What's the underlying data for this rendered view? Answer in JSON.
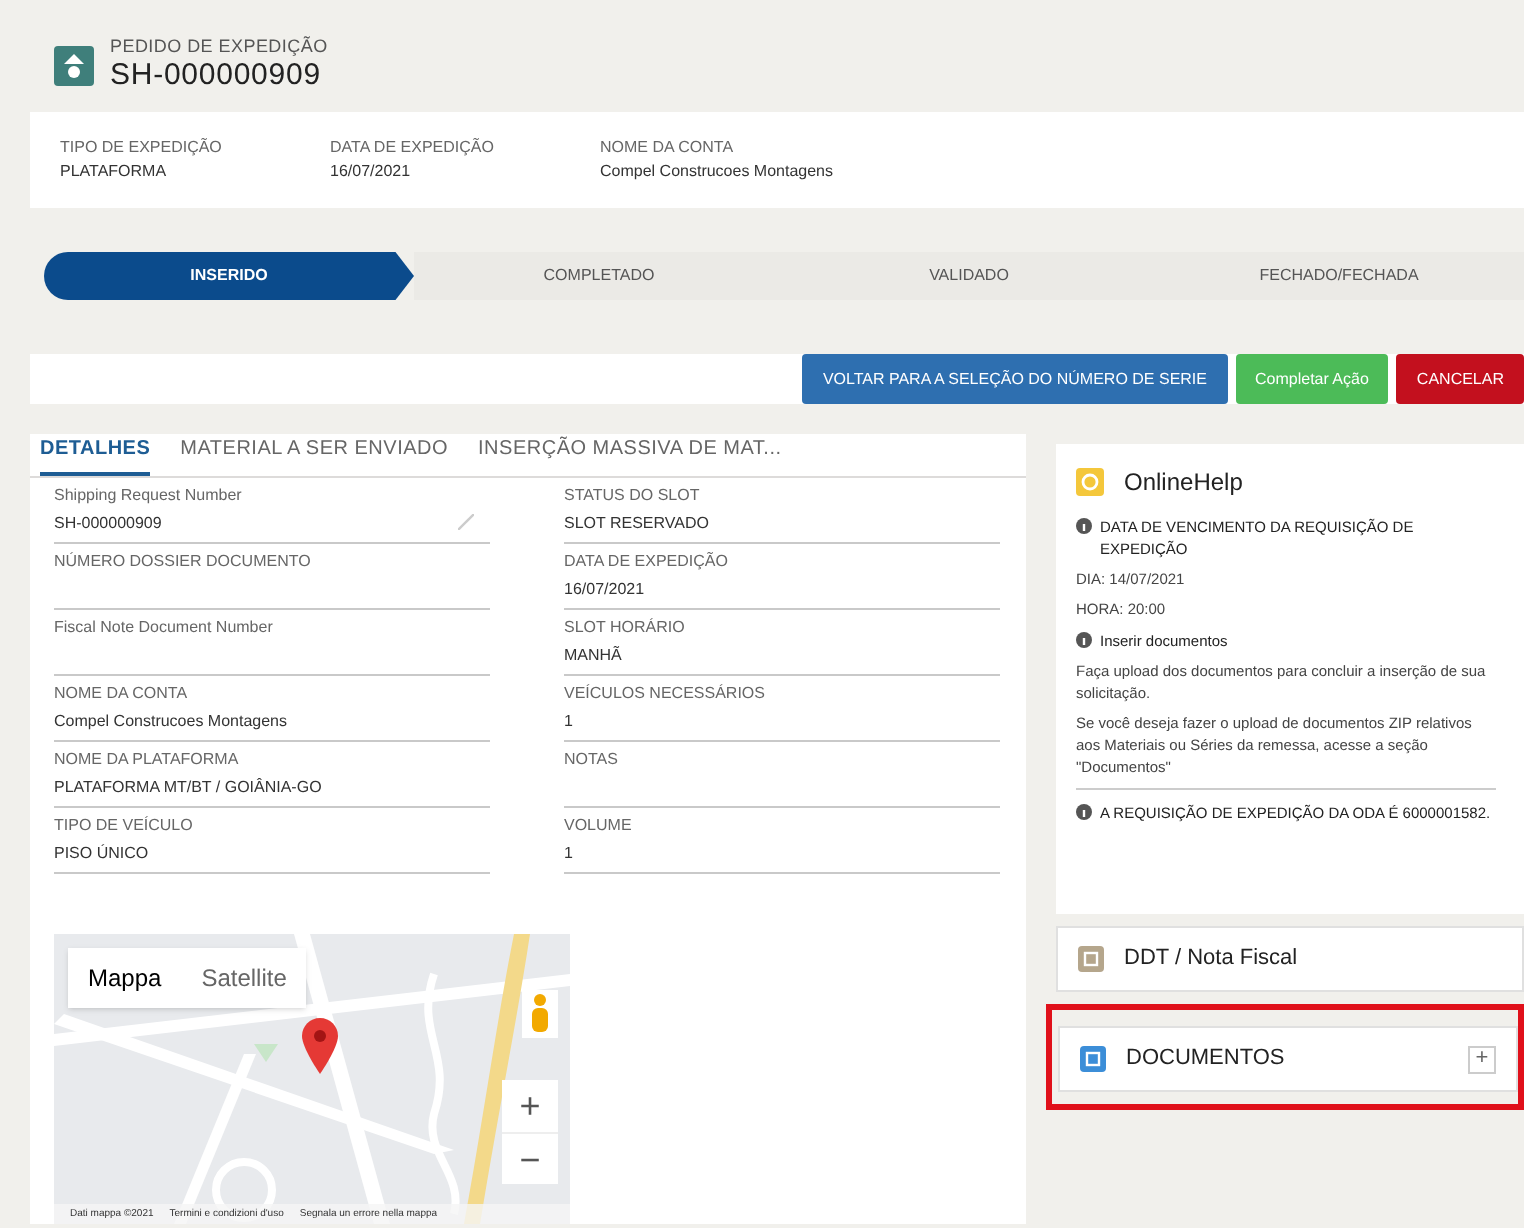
{
  "header": {
    "object_type": "PEDIDO DE EXPEDIÇÃO",
    "record_name": "SH-000000909"
  },
  "highlights": [
    {
      "label": "TIPO DE EXPEDIÇÃO",
      "value": "PLATAFORMA"
    },
    {
      "label": "DATA DE EXPEDIÇÃO",
      "value": "16/07/2021"
    },
    {
      "label": "NOME DA CONTA",
      "value": "Compel Construcoes Montagens"
    }
  ],
  "path": [
    {
      "label": "INSERIDO",
      "selected": true
    },
    {
      "label": "COMPLETADO",
      "selected": false
    },
    {
      "label": "VALIDADO",
      "selected": false
    },
    {
      "label": "FECHADO/FECHADA",
      "selected": false
    }
  ],
  "actions": [
    {
      "label": "VOLTAR PARA A SELEÇÃO DO NÚMERO DE SERIE",
      "kind": "primary"
    },
    {
      "label": "Completar Ação",
      "kind": "success"
    },
    {
      "label": "CANCELAR",
      "kind": "danger"
    }
  ],
  "tabs": [
    {
      "label": "DETALHES",
      "selected": true
    },
    {
      "label": "MATERIAL A SER ENVIADO",
      "selected": false
    },
    {
      "label": "INSERÇÃO MASSIVA DE MAT...",
      "selected": false
    }
  ],
  "fields": [
    [
      {
        "label": "Shipping Request Number",
        "value": "SH-000000909",
        "kind": "editable"
      },
      {
        "label": "STATUS DO SLOT",
        "value": "SLOT RESERVADO",
        "kind": "plain"
      }
    ],
    [
      {
        "label": "NÚMERO DOSSIER DOCUMENTO",
        "kind": "plain"
      },
      {
        "label": "DATA DE EXPEDIÇÃO",
        "value": "16/07/2021",
        "kind": "plain"
      }
    ],
    [
      {
        "label": "Fiscal Note Document Number",
        "kind": "plain"
      },
      {
        "label": "SLOT HORÁRIO",
        "value": "MANHÃ",
        "kind": "plain"
      }
    ],
    [
      {
        "label": "NOME DA CONTA",
        "value": "Compel Construcoes Montagens",
        "kind": "plain"
      },
      {
        "label": "VEÍCULOS NECESSÁRIOS",
        "value": "1",
        "kind": "plain"
      }
    ],
    [
      {
        "label": "NOME DA PLATAFORMA",
        "value": "PLATAFORMA MT/BT / GOIÂNIA-GO",
        "kind": "plain"
      },
      {
        "label": "NOTAS",
        "kind": "plain"
      }
    ],
    [
      {
        "label": "TIPO DE VEÍCULO",
        "value": "PISO ÚNICO",
        "kind": "plain"
      },
      {
        "label": "VOLUME",
        "value": "1",
        "kind": "plain"
      }
    ]
  ],
  "map": {
    "types": [
      {
        "label": "Mappa",
        "selected": true
      },
      {
        "label": "Satellite",
        "selected": false
      }
    ],
    "zoom_in": "+",
    "zoom_out": "−",
    "footer": [
      "Dati mappa ©2021",
      "Termini e condizioni d'uso",
      "Segnala un errore nella mappa"
    ]
  },
  "online_help": {
    "title": "OnlineHelp",
    "sections": [
      {
        "heading": "DATA DE VENCIMENTO DA REQUISIÇÃO DE EXPEDIÇÃO",
        "lines": [
          "DIA: 14/07/2021",
          "HORA: 20:00"
        ]
      },
      {
        "heading": "Inserir documentos",
        "lines": [
          "Faça upload dos documentos para concluir a inserção de sua solicitação.",
          "Se você deseja fazer o upload de documentos ZIP relativos aos Materiais ou Séries da remessa, acesse a seção \"Documentos\""
        ]
      },
      {
        "heading": "A REQUISIÇÃO DE EXPEDIÇÃO DA ODA É 6000001582."
      }
    ]
  },
  "related": [
    {
      "title": "DDT / Nota Fiscal",
      "kind": "file",
      "highlighted": false
    },
    {
      "title": "DOCUMENTOS",
      "kind": "doc",
      "highlighted": true,
      "add": "+"
    }
  ]
}
